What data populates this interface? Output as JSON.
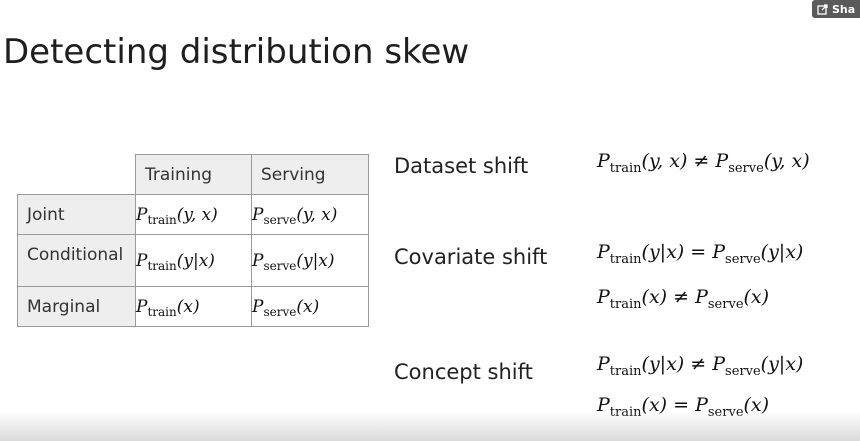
{
  "share": {
    "label": "Sha",
    "icon": "share-icon"
  },
  "title": "Detecting distribution skew",
  "table": {
    "headers": [
      "Training",
      "Serving"
    ],
    "rows": [
      {
        "label": "Joint",
        "training": {
          "sub": "train",
          "args": "(y, x)"
        },
        "serving": {
          "sub": "serve",
          "args": "(y, x)"
        }
      },
      {
        "label": "Conditional",
        "training": {
          "sub": "train",
          "args": "(y|x)"
        },
        "serving": {
          "sub": "serve",
          "args": "(y|x)"
        }
      },
      {
        "label": "Marginal",
        "training": {
          "sub": "train",
          "args": "(x)"
        },
        "serving": {
          "sub": "serve",
          "args": "(x)"
        }
      }
    ]
  },
  "shifts": [
    {
      "label": "Dataset shift",
      "equations": [
        {
          "lsub": "train",
          "largs": "(y, x)",
          "op": "≠",
          "rsub": "serve",
          "rargs": "(y, x)"
        }
      ]
    },
    {
      "label": "Covariate shift",
      "equations": [
        {
          "lsub": "train",
          "largs": "(y|x)",
          "op": "=",
          "rsub": "serve",
          "rargs": "(y|x)"
        },
        {
          "lsub": "train",
          "largs": "(x)",
          "op": "≠",
          "rsub": "serve",
          "rargs": "(x)"
        }
      ]
    },
    {
      "label": "Concept shift",
      "equations": [
        {
          "lsub": "train",
          "largs": "(y|x)",
          "op": "≠",
          "rsub": "serve",
          "rargs": "(y|x)"
        },
        {
          "lsub": "train",
          "largs": "(x)",
          "op": "=",
          "rsub": "serve",
          "rargs": "(x)"
        }
      ]
    }
  ],
  "symbol": "P"
}
